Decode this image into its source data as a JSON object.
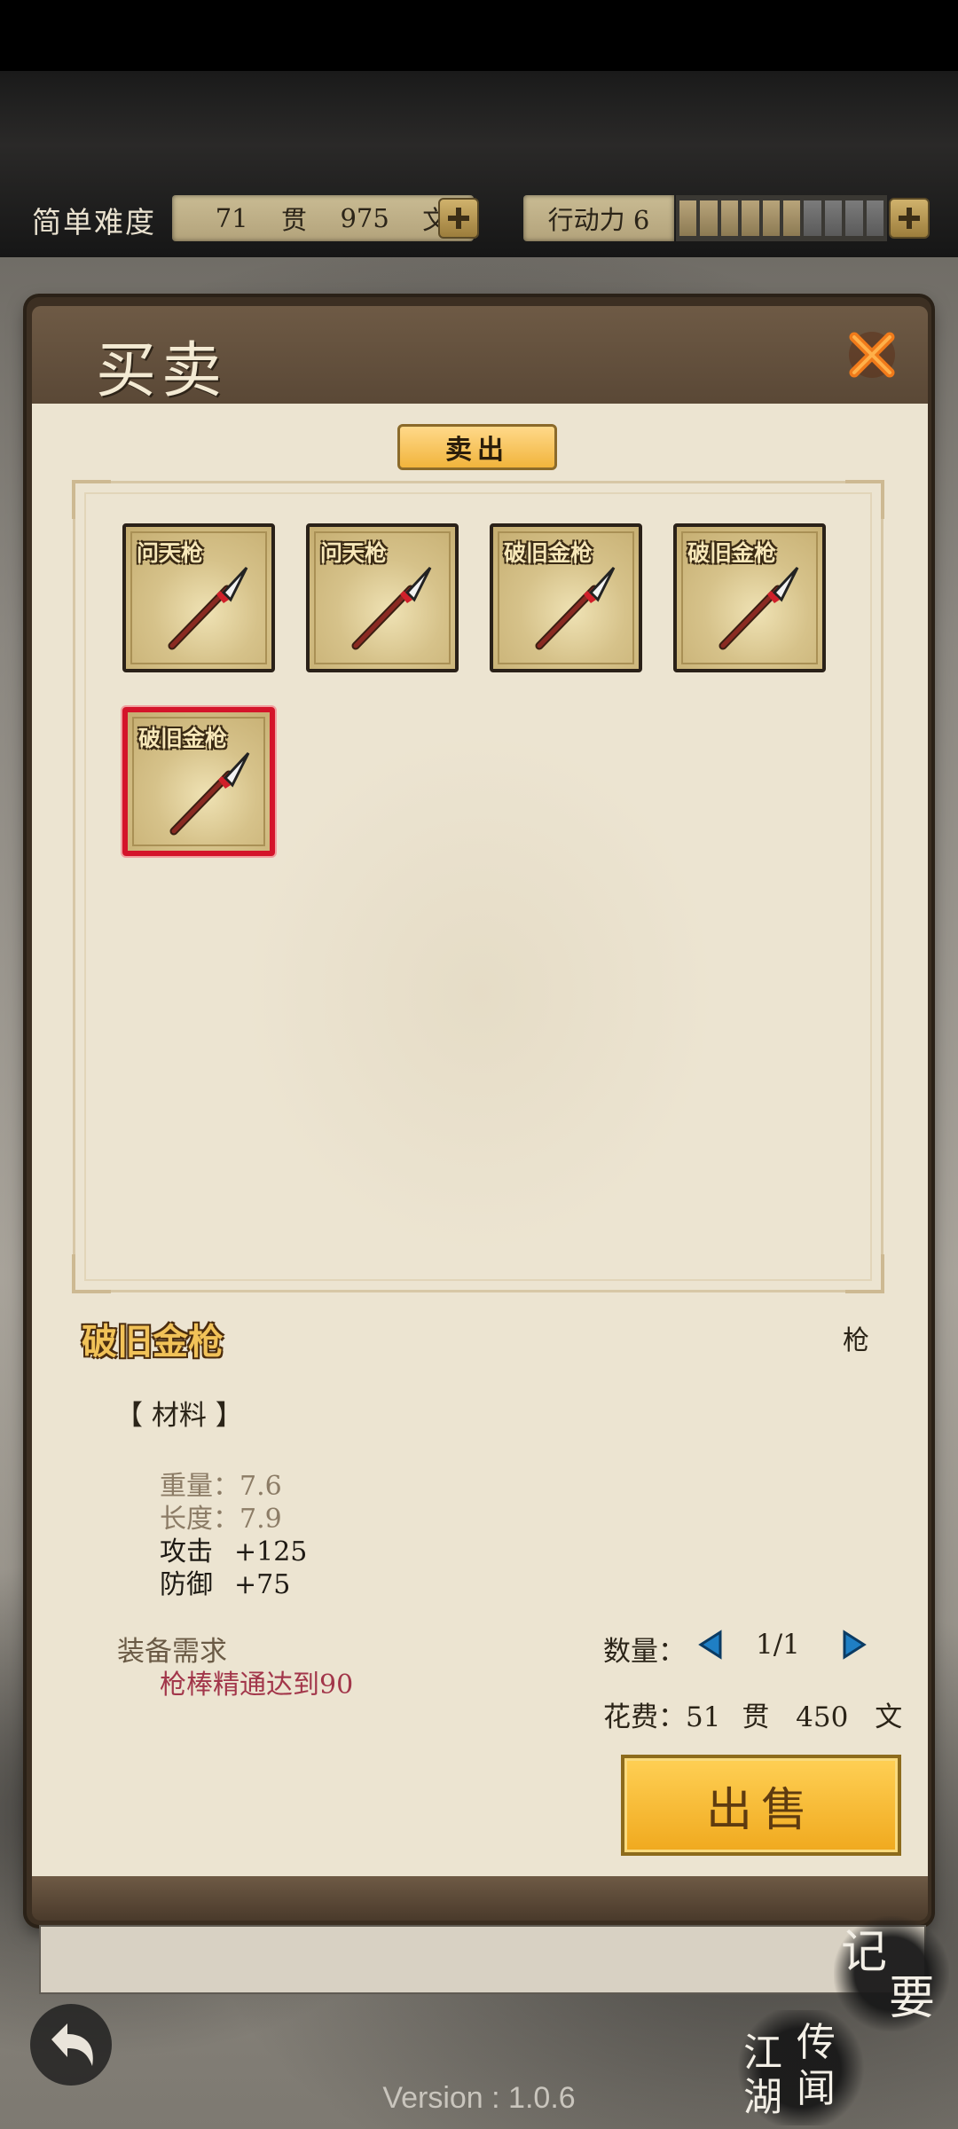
{
  "status_bar": {
    "difficulty": "简单难度",
    "money_guan": "71",
    "money_guan_unit": "贯",
    "money_wen": "975",
    "money_wen_unit": "文",
    "action_points_label": "行动力 6",
    "action_points_value": 6,
    "action_points_max": 10
  },
  "dialog": {
    "title": "买卖",
    "tab_sell": "卖出"
  },
  "items": [
    {
      "name": "问天枪",
      "selected": false
    },
    {
      "name": "问天枪",
      "selected": false
    },
    {
      "name": "破旧金枪",
      "selected": false
    },
    {
      "name": "破旧金枪",
      "selected": false
    },
    {
      "name": "破旧金枪",
      "selected": true
    }
  ],
  "detail": {
    "name": "破旧金枪",
    "type": "枪",
    "category": "【 材料 】",
    "stats": [
      {
        "label": "重量：",
        "value": "7.6"
      },
      {
        "label": "长度：",
        "value": "7.9"
      },
      {
        "label": "攻击",
        "value": "+125"
      },
      {
        "label": "防御",
        "value": "+75"
      }
    ],
    "requirement_title": "装备需求",
    "requirement_text": "枪棒精通达到90"
  },
  "trade": {
    "quantity_label": "数量：",
    "quantity_value": "1/1",
    "cost_label": "花费：",
    "cost_guan": "51",
    "cost_guan_unit": "贯",
    "cost_wen": "450",
    "cost_wen_unit": "文",
    "sell_button": "出售"
  },
  "footer": {
    "notes_char1": "记",
    "notes_char2": "要",
    "legend_chars": [
      "江",
      "湖",
      "传",
      "闻"
    ],
    "version": "Version : 1.0.6"
  },
  "colors": {
    "accent_gold": "#f1b43c",
    "selected_border": "#d4142a",
    "requirement_red": "#a2364a"
  }
}
